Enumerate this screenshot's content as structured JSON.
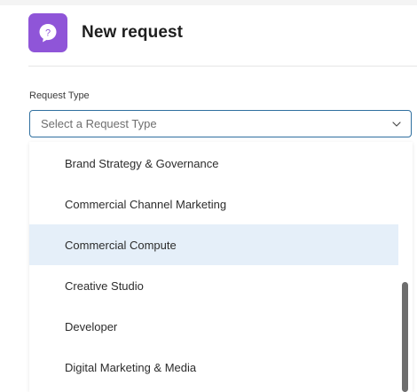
{
  "header": {
    "icon": "question-bubble-icon",
    "icon_color": "#8f55d8",
    "title": "New request"
  },
  "form": {
    "request_type_label": "Request Type",
    "request_type_placeholder": "Select a Request Type"
  },
  "dropdown": {
    "options": [
      {
        "label": "Brand Strategy & Governance"
      },
      {
        "label": "Commercial Channel Marketing"
      },
      {
        "label": "Commercial Compute"
      },
      {
        "label": "Creative Studio"
      },
      {
        "label": "Developer"
      },
      {
        "label": "Digital Marketing & Media"
      }
    ],
    "highlighted_option": "Commercial Compute",
    "highlight_color": "#e5eff9"
  },
  "colors": {
    "select_border": "#2f6f9f",
    "scrollbar_thumb": "#6e6e6e"
  }
}
